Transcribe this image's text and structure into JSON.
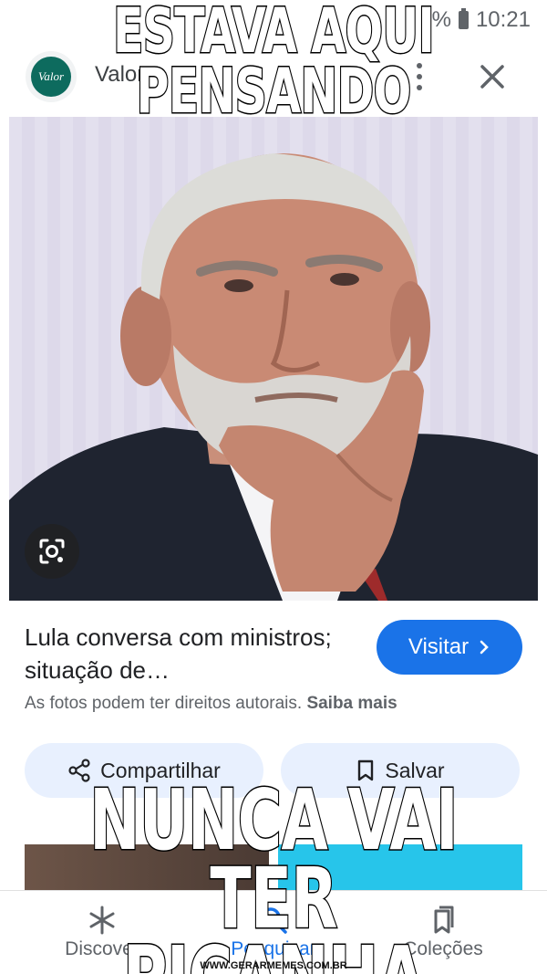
{
  "status_bar": {
    "time": "10:21",
    "battery_percent": "%"
  },
  "header": {
    "site_logo_text": "Valor",
    "site_name": "Valor"
  },
  "caption": {
    "title": "Lula conversa com ministros; situação de…",
    "visit_label": "Visitar",
    "rights_text": "As fotos podem ter direitos autorais.",
    "rights_link": "Saiba mais"
  },
  "actions": {
    "share_label": "Compartilhar",
    "save_label": "Salvar"
  },
  "bottom_nav": {
    "items": [
      {
        "label": "Discover",
        "icon": "asterisk-icon",
        "active": false
      },
      {
        "label": "Pesquisar",
        "icon": "search-icon",
        "active": true
      },
      {
        "label": "Coleções",
        "icon": "collections-icon",
        "active": false
      }
    ]
  },
  "meme": {
    "top_line_1": "ESTAVA AQUI",
    "top_line_2": "PENSANDO",
    "bottom_line_1": "NUNCA VAI TER",
    "bottom_line_2": "PICANHA",
    "watermark": "WWW.GERARMEMES.COM.BR"
  },
  "colors": {
    "accent": "#1a73e8",
    "chip": "#e8f0fe",
    "logo": "#0d6b5e"
  }
}
